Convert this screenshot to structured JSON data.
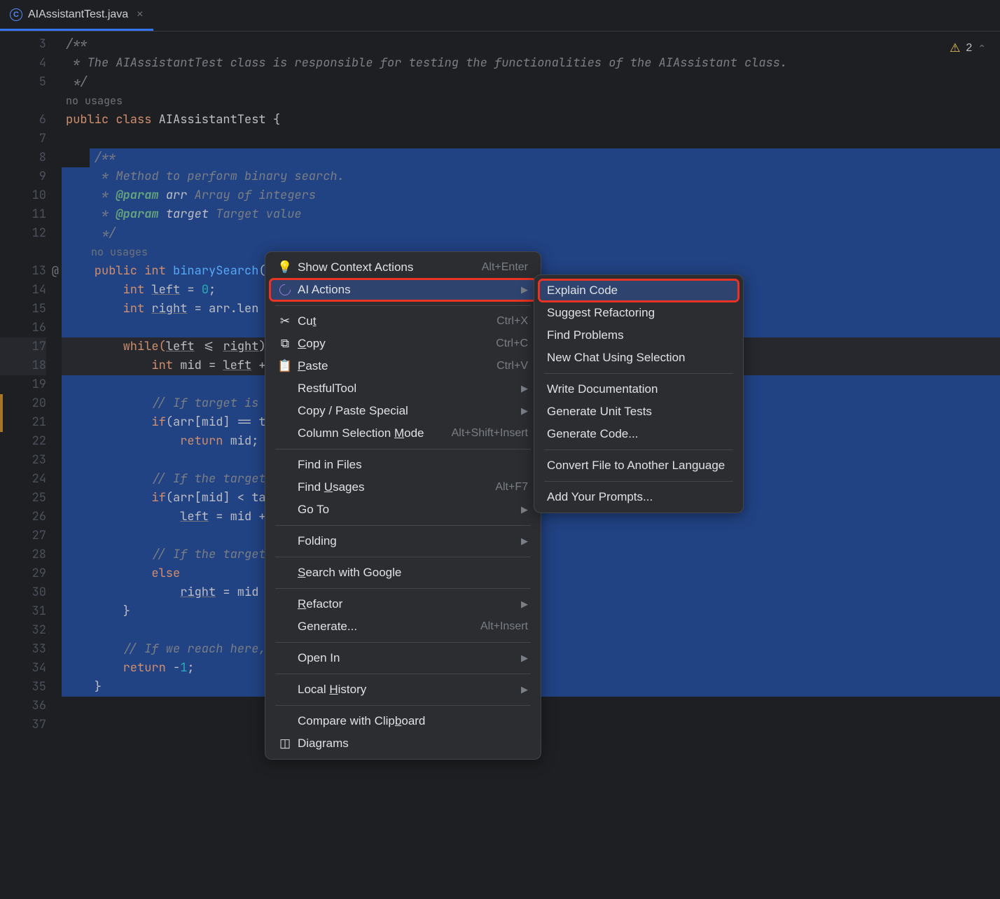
{
  "tab": {
    "name": "AIAssistantTest.java"
  },
  "warnings": {
    "count": "2"
  },
  "gutter": {
    "lines": [
      "3",
      "4",
      "5",
      "",
      "6",
      "7",
      "8",
      "9",
      "10",
      "11",
      "12",
      "",
      "13",
      "14",
      "15",
      "16",
      "17",
      "18",
      "19",
      "20",
      "21",
      "22",
      "23",
      "24",
      "25",
      "26",
      "27",
      "28",
      "29",
      "30",
      "31",
      "32",
      "33",
      "34",
      "35",
      "36",
      "37"
    ]
  },
  "code": {
    "l3": "/**",
    "l4": " * The AIAssistantTest class is responsible for testing the functionalities of the AIAssistant class.",
    "l5": " */",
    "hint1": "no usages",
    "l6a": "public ",
    "l6b": "class ",
    "l6c": "AIAssistantTest ",
    "l6d": "{",
    "l8": "    /**",
    "l9": "     * Method to perform binary search.",
    "l10a": "     * ",
    "l10b": "@param ",
    "l10c": "arr ",
    "l10d": "Array of integers",
    "l11a": "     * ",
    "l11b": "@param ",
    "l11c": "target ",
    "l11d": "Target value",
    "l12": "     */",
    "hint2": "    no usages",
    "l13a": "    public ",
    "l13b": "int ",
    "l13c": "binarySearch",
    "l13d": "(",
    "l14a": "        int ",
    "l14b": "left",
    "l14c": " = ",
    "l14d": "0",
    "l14e": ";",
    "l15a": "        int ",
    "l15b": "right",
    "l15c": " = arr.len",
    "l17a": "        while(",
    "l17b": "left",
    "l17c": " <= ",
    "l17d": "right",
    "l17e": ")",
    "l18a": "            int ",
    "l18b": "mid = ",
    "l18c": "left",
    "l18d": " +",
    "l20a": "            // If target is p",
    "l21a": "            if",
    "l21b": "(arr[mid] == ta",
    "l22a": "                return ",
    "l22b": "mid;",
    "l24": "            // If the target",
    "l25a": "            if",
    "l25b": "(arr[mid] < ta",
    "l26a": "                ",
    "l26b": "left",
    "l26c": " = mid +",
    "l28": "            // If the target",
    "l29": "            else",
    "l30a": "                ",
    "l30b": "right",
    "l30c": " = mid",
    "l31": "        }",
    "l33": "        // If we reach here,",
    "l34a": "        return ",
    "l34b": "-",
    "l34c": "1",
    "l34d": ";",
    "l35": "    } "
  },
  "menu": {
    "showContext": "Show Context Actions",
    "showContextKey": "Alt+Enter",
    "aiActions": "AI Actions",
    "cut": "Cut",
    "cutKey": "Ctrl+X",
    "copy": "Copy",
    "copyKey": "Ctrl+C",
    "paste": "Paste",
    "pasteKey": "Ctrl+V",
    "restful": "RestfulTool",
    "copyPS": "Copy / Paste Special",
    "colSel": "Column Selection Mode",
    "colSelKey": "Alt+Shift+Insert",
    "findFiles": "Find in Files",
    "findUsages": "Find Usages",
    "findUsagesKey": "Alt+F7",
    "goTo": "Go To",
    "folding": "Folding",
    "searchGoogle": "Search with Google",
    "refactor": "Refactor",
    "generate": "Generate...",
    "generateKey": "Alt+Insert",
    "openIn": "Open In",
    "localHist": "Local History",
    "compare": "Compare with Clipboard",
    "diagrams": "Diagrams"
  },
  "submenu": {
    "explain": "Explain Code",
    "suggest": "Suggest Refactoring",
    "findProb": "Find Problems",
    "newChat": "New Chat Using Selection",
    "writeDoc": "Write Documentation",
    "genTests": "Generate Unit Tests",
    "genCode": "Generate Code...",
    "convert": "Convert File to Another Language",
    "addPrompts": "Add Your Prompts..."
  }
}
